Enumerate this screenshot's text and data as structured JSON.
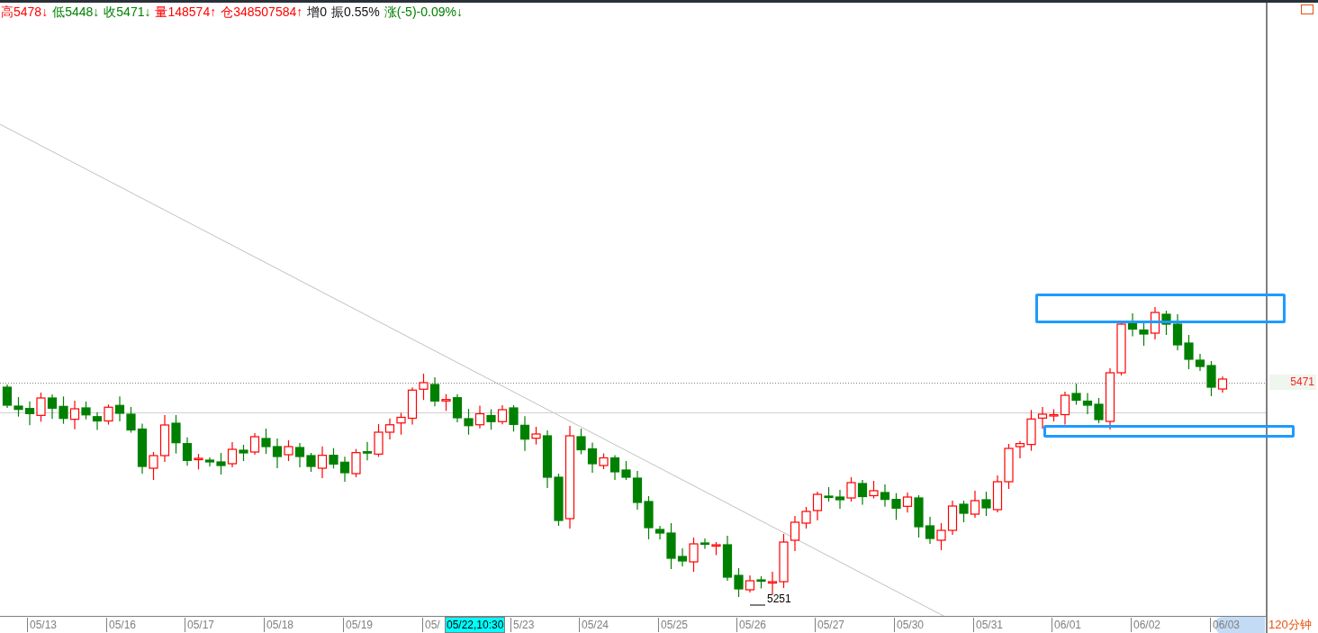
{
  "header": {
    "items": [
      {
        "text": "高5478↓",
        "color": "#ff0000"
      },
      {
        "text": "低5448↓",
        "color": "#008000"
      },
      {
        "text": "收5471↓",
        "color": "#008000"
      },
      {
        "text": "量148574↑",
        "color": "#ff0000"
      },
      {
        "text": "仓348507584↑",
        "color": "#ff0000"
      },
      {
        "text": "增0"
      },
      {
        "text": "振0.55%"
      },
      {
        "text": "涨(-5)-0.09%↓",
        "color": "#008000"
      }
    ]
  },
  "chart": {
    "last_price": "5471",
    "low_label": "5251",
    "x_labels": [
      "05/13",
      "05/16",
      "05/17",
      "05/18",
      "05/19",
      "05/",
      "5/23",
      "05/24",
      "05/25",
      "05/26",
      "05/27",
      "05/30",
      "05/31",
      "06/01",
      "06/02",
      "06/03"
    ],
    "crosshair_label": "05/22,10:30"
  },
  "period": "120分钟"
}
